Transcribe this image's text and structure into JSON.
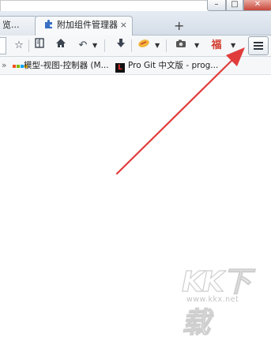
{
  "window_controls": {
    "minimize": "–",
    "maximize": "□",
    "close": "✕"
  },
  "tabs": [
    {
      "label": "览..."
    },
    {
      "label": "附加组件管理器",
      "close": "×"
    }
  ],
  "new_tab": "+",
  "toolbar": {
    "icons": [
      "star-icon",
      "reading-list-icon",
      "home-icon",
      "back-icon",
      "download-icon",
      "addon-icon",
      "screenshot-icon",
      "fu-icon",
      "menu-icon"
    ],
    "fu_char": "福"
  },
  "bookmarks": [
    {
      "label": "模型-视图-控制器 (M..."
    },
    {
      "label": "Pro Git 中文版 - prog..."
    }
  ],
  "watermark": {
    "logo": "KK下载",
    "url": "www.kkx.net"
  },
  "colors": {
    "arrow": "#e03c3c",
    "tab_bar": "#dce4ed",
    "toolbar": "#f5f7f9"
  }
}
